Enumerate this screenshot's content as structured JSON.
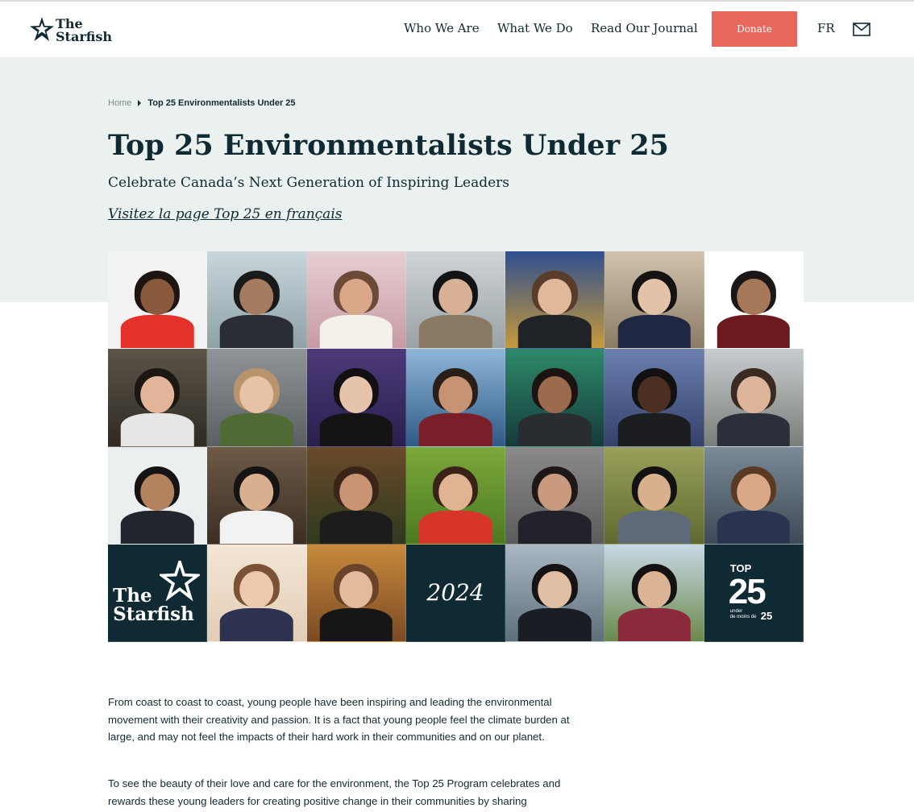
{
  "header": {
    "logo": {
      "line1": "The",
      "line2": "Starfish",
      "icon": "starfish-star-icon"
    },
    "nav": [
      "Who We Are",
      "What We Do",
      "Read Our Journal"
    ],
    "donate_label": "Donate",
    "lang_label": "FR",
    "mail_icon": "mail-icon"
  },
  "breadcrumb": {
    "home": "Home",
    "current": "Top 25 Environmentalists Under 25"
  },
  "hero": {
    "title": "Top 25 Environmentalists Under 25",
    "subtitle": "Celebrate Canada’s Next Generation of Inspiring Leaders",
    "french_link": "Visitez la page Top 25 en français"
  },
  "grid": {
    "brand_tile": {
      "line1": "The",
      "line2": "Starfish"
    },
    "year_tile": "2024",
    "top25_tile": {
      "top": "TOP",
      "number": "25",
      "under": "under",
      "fr": "de moins de",
      "number2": "25"
    }
  },
  "body": {
    "paragraphs": [
      "From coast to coast to coast, young people have been inspiring and leading the environmental movement with their creativity and passion. It is a fact that young people feel the climate burden at large, and may not feel the impacts of their hard work in their communities and on our planet.",
      "To see the beauty of their love and care for the environment, the Top 25 Program celebrates and rewards these young leaders for creating positive change in their communities by sharing"
    ]
  },
  "colors": {
    "navy": "#0f2a33",
    "coral": "#e8685d",
    "hero_bg": "#ebf1ee"
  }
}
